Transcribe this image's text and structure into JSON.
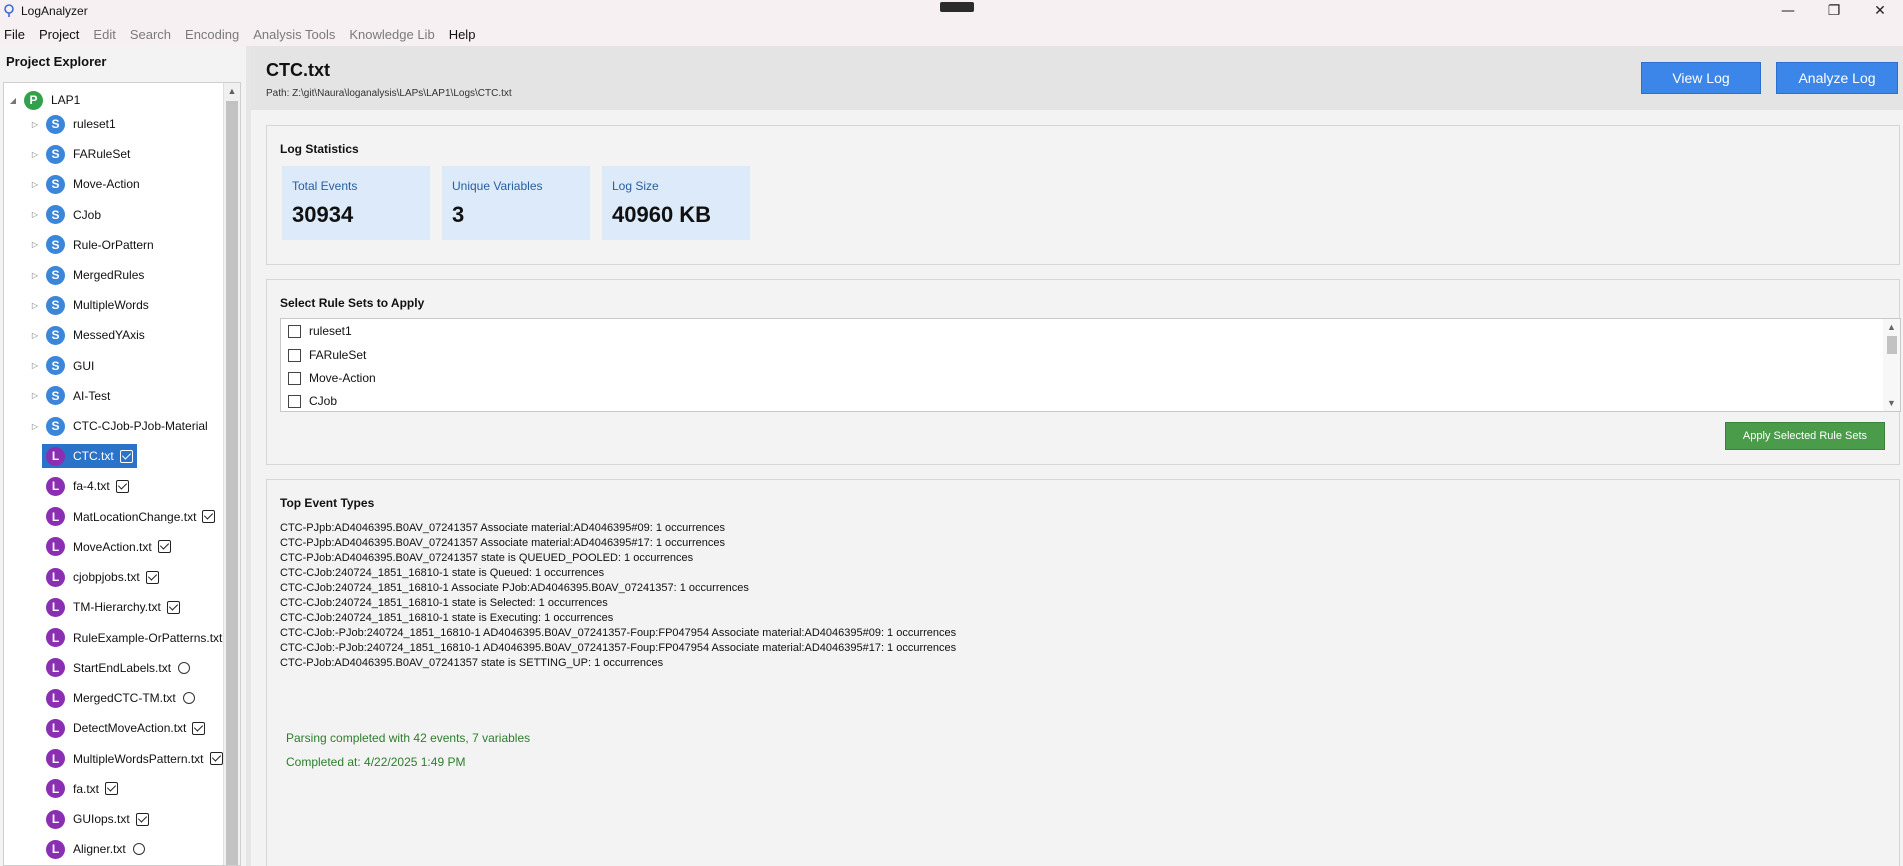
{
  "window": {
    "title": "LogAnalyzer",
    "controls": [
      "—",
      "❐",
      "✕"
    ]
  },
  "menu": [
    "File",
    "Project",
    "Edit",
    "Search",
    "Encoding",
    "Analysis Tools",
    "Knowledge Lib",
    "Help"
  ],
  "sidebar": {
    "header": "Project Explorer",
    "project": {
      "badge": "P",
      "label": "LAP1"
    },
    "rule_sets": [
      {
        "badge": "S",
        "label": "ruleset1"
      },
      {
        "badge": "S",
        "label": "FARuleSet"
      },
      {
        "badge": "S",
        "label": "Move-Action"
      },
      {
        "badge": "S",
        "label": "CJob"
      },
      {
        "badge": "S",
        "label": "Rule-OrPattern"
      },
      {
        "badge": "S",
        "label": "MergedRules"
      },
      {
        "badge": "S",
        "label": "MultipleWords"
      },
      {
        "badge": "S",
        "label": "MessedYAxis"
      },
      {
        "badge": "S",
        "label": "GUI"
      },
      {
        "badge": "S",
        "label": "AI-Test"
      },
      {
        "badge": "S",
        "label": "CTC-CJob-PJob-Material"
      }
    ],
    "logs": [
      {
        "badge": "L",
        "label": "CTC.txt",
        "status": "checked",
        "selected": true
      },
      {
        "badge": "L",
        "label": "fa-4.txt",
        "status": "checked"
      },
      {
        "badge": "L",
        "label": "MatLocationChange.txt",
        "status": "checked"
      },
      {
        "badge": "L",
        "label": "MoveAction.txt",
        "status": "checked"
      },
      {
        "badge": "L",
        "label": "cjobpjobs.txt",
        "status": "checked"
      },
      {
        "badge": "L",
        "label": "TM-Hierarchy.txt",
        "status": "checked"
      },
      {
        "badge": "L",
        "label": "RuleExample-OrPatterns.txt",
        "status": "none"
      },
      {
        "badge": "L",
        "label": "StartEndLabels.txt",
        "status": "circle"
      },
      {
        "badge": "L",
        "label": "MergedCTC-TM.txt",
        "status": "circle"
      },
      {
        "badge": "L",
        "label": "DetectMoveAction.txt",
        "status": "checked"
      },
      {
        "badge": "L",
        "label": "MultipleWordsPattern.txt",
        "status": "checked"
      },
      {
        "badge": "L",
        "label": "fa.txt",
        "status": "checked"
      },
      {
        "badge": "L",
        "label": "GUIops.txt",
        "status": "checked"
      },
      {
        "badge": "L",
        "label": "Aligner.txt",
        "status": "circle"
      }
    ]
  },
  "header": {
    "file_name": "CTC.txt",
    "path": "Path: Z:\\git\\Naura\\loganalysis\\LAPs\\LAP1\\Logs\\CTC.txt",
    "view_log_label": "View Log",
    "analyze_log_label": "Analyze Log"
  },
  "stats": {
    "title": "Log Statistics",
    "items": [
      {
        "label": "Total Events",
        "value": "30934"
      },
      {
        "label": "Unique Variables",
        "value": "3"
      },
      {
        "label": "Log Size",
        "value": "40960 KB"
      }
    ]
  },
  "rules": {
    "title": "Select Rule Sets to Apply",
    "items": [
      "ruleset1",
      "FARuleSet",
      "Move-Action",
      "CJob"
    ],
    "apply_label": "Apply Selected Rule Sets"
  },
  "events": {
    "title": "Top Event Types",
    "lines": [
      "CTC-PJpb:AD4046395.B0AV_07241357  Associate material:AD4046395#09: 1 occurrences",
      "CTC-PJpb:AD4046395.B0AV_07241357  Associate material:AD4046395#17: 1 occurrences",
      "CTC-PJob:AD4046395.B0AV_07241357 state is QUEUED_POOLED: 1 occurrences",
      "CTC-CJob:240724_1851_16810-1 state is Queued: 1 occurrences",
      "CTC-CJob:240724_1851_16810-1 Associate PJob:AD4046395.B0AV_07241357: 1 occurrences",
      "CTC-CJob:240724_1851_16810-1 state is Selected: 1 occurrences",
      "CTC-CJob:240724_1851_16810-1 state is Executing: 1 occurrences",
      "CTC-CJob:-PJob:240724_1851_16810-1 AD4046395.B0AV_07241357-Foup:FP047954 Associate material:AD4046395#09: 1 occurrences",
      "CTC-CJob:-PJob:240724_1851_16810-1 AD4046395.B0AV_07241357-Foup:FP047954 Associate material:AD4046395#17: 1 occurrences",
      "CTC-PJob:AD4046395.B0AV_07241357 state is SETTING_UP: 1 occurrences"
    ],
    "status": "Parsing completed with 42 events, 7 variables",
    "completed": "Completed at: 4/22/2025 1:49 PM"
  },
  "colors": {
    "accent": "#3b86e8",
    "apply": "#4a9b4a",
    "status_text": "#2e7d2e",
    "selected": "#2b73c9"
  }
}
